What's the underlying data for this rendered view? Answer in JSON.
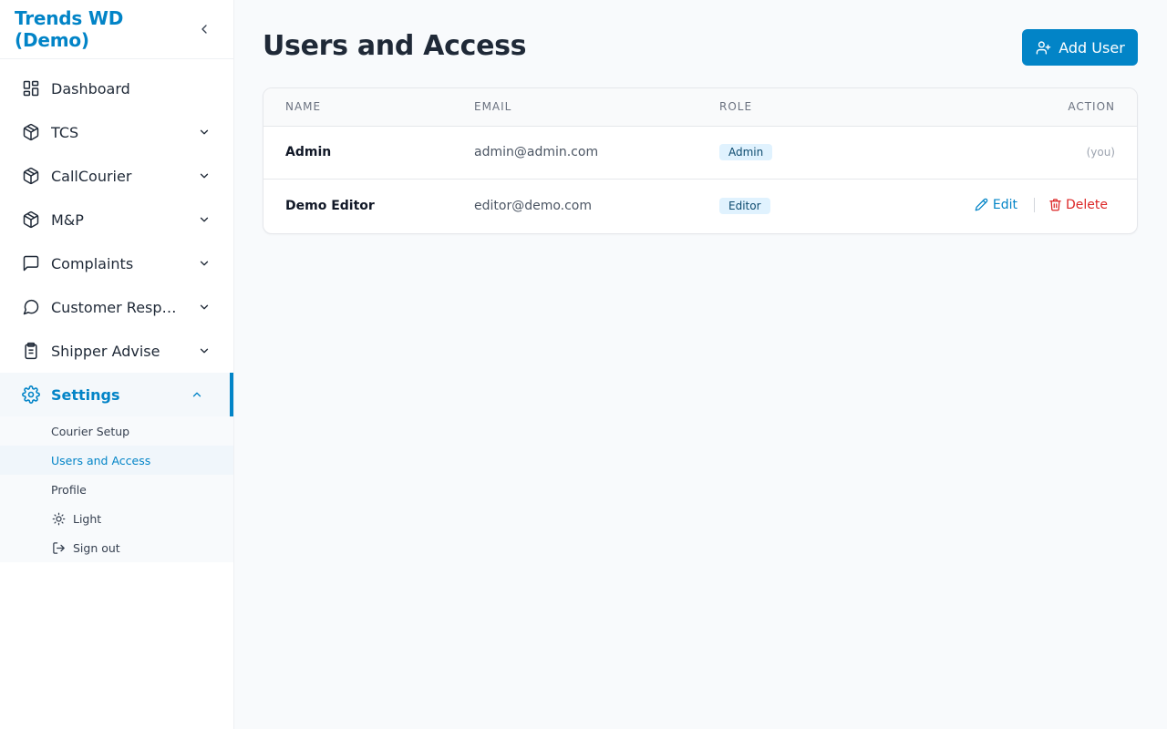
{
  "brand": {
    "title": "Trends WD (Demo)"
  },
  "sidebar": {
    "items": [
      {
        "label": "Dashboard",
        "icon": "dashboard-icon"
      },
      {
        "label": "TCS",
        "icon": "package-icon"
      },
      {
        "label": "CallCourier",
        "icon": "package-icon"
      },
      {
        "label": "M&P",
        "icon": "package-icon"
      },
      {
        "label": "Complaints",
        "icon": "message-square-icon"
      },
      {
        "label": "Customer Responses",
        "icon": "message-circle-icon"
      },
      {
        "label": "Shipper Advise",
        "icon": "clipboard-list-icon"
      },
      {
        "label": "Settings",
        "icon": "gear-icon"
      }
    ],
    "settings_sub": [
      {
        "label": "Courier Setup"
      },
      {
        "label": "Users and Access"
      },
      {
        "label": "Profile"
      }
    ],
    "theme_label": "Light",
    "signout_label": "Sign out"
  },
  "page": {
    "title": "Users and Access",
    "add_button": "Add User"
  },
  "table": {
    "headers": [
      "NAME",
      "EMAIL",
      "ROLE",
      "ACTION"
    ],
    "rows": [
      {
        "name": "Admin",
        "email": "admin@admin.com",
        "role": "Admin",
        "note": "(you)"
      },
      {
        "name": "Demo Editor",
        "email": "editor@demo.com",
        "role": "Editor",
        "edit": "Edit",
        "delete": "Delete"
      }
    ]
  },
  "colors": {
    "accent": "#0284c7",
    "danger": "#dc2626",
    "badge_bg": "#e0f2fe"
  }
}
